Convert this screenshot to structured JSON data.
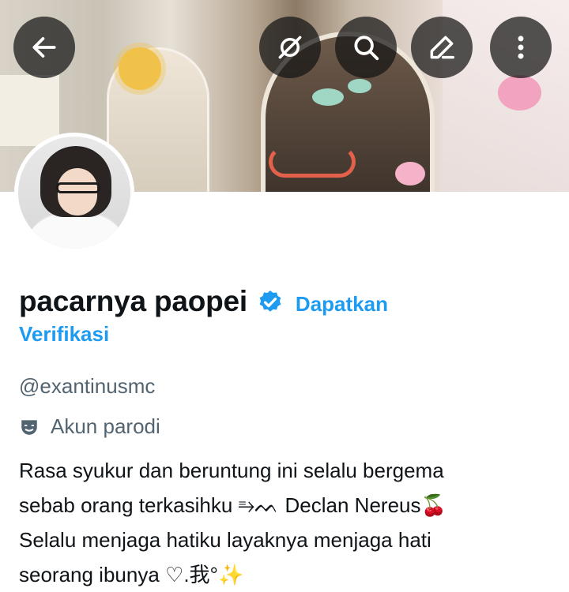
{
  "header": {
    "buttons": [
      {
        "name": "back-button",
        "icon": "arrow-left-icon"
      },
      {
        "name": "hide-button",
        "icon": "eye-off-icon"
      },
      {
        "name": "search-button",
        "icon": "search-icon"
      },
      {
        "name": "edit-button",
        "icon": "pencil-icon"
      },
      {
        "name": "more-button",
        "icon": "more-vertical-icon"
      }
    ]
  },
  "profile": {
    "display_name": "pacarnya paopei",
    "get_verified_label": "Dapatkan",
    "get_verified_label_2": "Verifikasi",
    "handle": "@exantinusmc",
    "parody_label": "Akun parodi",
    "bio_lines": [
      "Rasa syukur dan beruntung ini selalu bergema",
      "sebab orang terkasihku ⥱ᨓ Declan Nereus🍒",
      "Selalu  menjaga hatiku layaknya menjaga hati",
      "seorang ibunya ♡.我°✨"
    ]
  },
  "colors": {
    "accent": "#1d9bf0",
    "text_primary": "#0f1419",
    "text_secondary": "#536471",
    "overlay_button": "#141414"
  }
}
